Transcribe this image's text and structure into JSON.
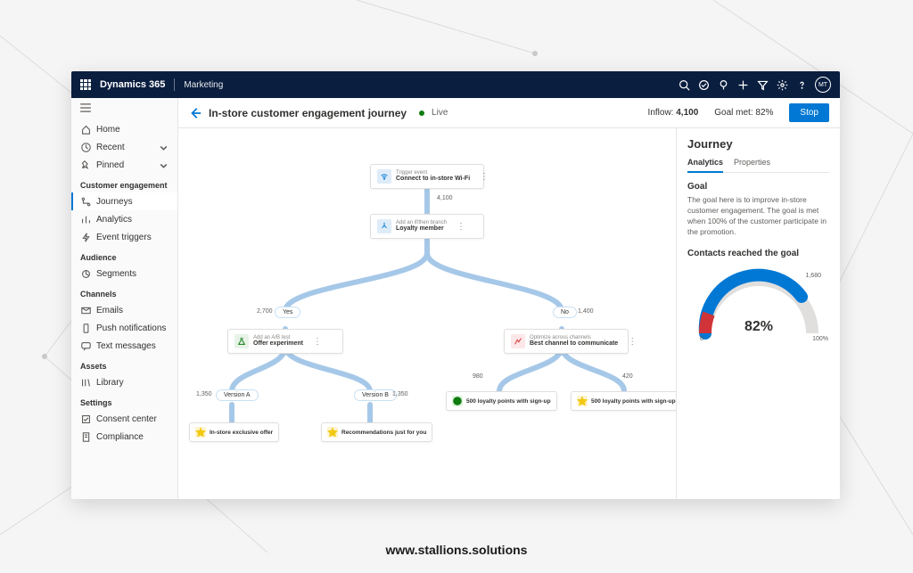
{
  "topbar": {
    "brand": "Dynamics 365",
    "sub": "Marketing",
    "avatar": "MT"
  },
  "sidebar": {
    "home": "Home",
    "recent": "Recent",
    "pinned": "Pinned",
    "groups": {
      "ce": "Customer engagement",
      "ce_items": {
        "journeys": "Journeys",
        "analytics": "Analytics",
        "triggers": "Event triggers"
      },
      "audience": "Audience",
      "audience_items": {
        "segments": "Segments"
      },
      "channels": "Channels",
      "channels_items": {
        "emails": "Emails",
        "push": "Push notifications",
        "text": "Text messages"
      },
      "assets": "Assets",
      "assets_items": {
        "library": "Library"
      },
      "settings": "Settings",
      "settings_items": {
        "consent": "Consent center",
        "compliance": "Compliance"
      }
    }
  },
  "header": {
    "title": "In-store customer engagement journey",
    "status": "Live",
    "inflow_label": "Inflow:",
    "inflow_value": "4,100",
    "goal_label": "Goal met:",
    "goal_value": "82%",
    "stop": "Stop"
  },
  "canvas": {
    "trigger": {
      "eyebrow": "Trigger event",
      "label": "Connect to in-store Wi-Fi"
    },
    "c1": "4,100",
    "branch": {
      "eyebrow": "Add an if/then branch",
      "label": "Loyalty member"
    },
    "yes": "Yes",
    "no": "No",
    "c_yes": "2,700",
    "c_no": "1,400",
    "ab": {
      "eyebrow": "Add an A/B test",
      "label": "Offer experiment"
    },
    "opt": {
      "eyebrow": "Optimize across channels",
      "label": "Best channel to communicate"
    },
    "va": "Version A",
    "vb": "Version B",
    "c_va": "1,350",
    "c_vb": "1,350",
    "c_opt_l": "980",
    "c_opt_r": "420",
    "offer1": "In-store exclusive offer",
    "offer2": "Recommendations just for you",
    "loyalty": "500 loyalty points with sign-up"
  },
  "rightpanel": {
    "title": "Journey",
    "tabs": {
      "analytics": "Analytics",
      "properties": "Properties"
    },
    "goal_h": "Goal",
    "goal_body": "The goal here is to improve in-store customer engagement. The goal is met when 100% of the customer participate in the promotion.",
    "contacts_h": "Contacts reached the goal",
    "gauge": {
      "value": "82%",
      "min": "0",
      "max": "100%",
      "count": "1,680"
    }
  },
  "chart_data": {
    "type": "gauge",
    "value_pct": 82,
    "range": [
      0,
      100
    ],
    "reached_count": 1680,
    "title": "Contacts reached the goal"
  },
  "footer": "www.stallions.solutions"
}
